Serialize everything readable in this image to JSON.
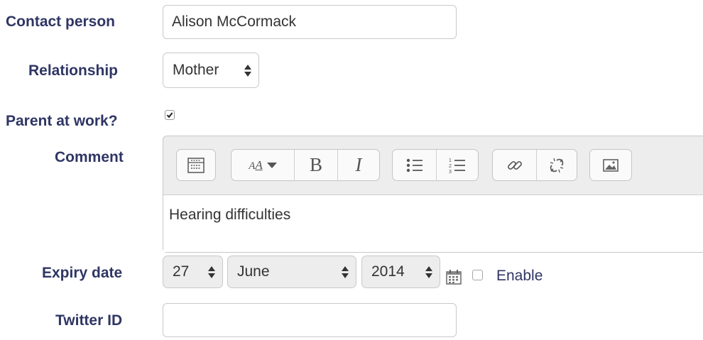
{
  "form": {
    "contact_person": {
      "label": "Contact person",
      "value": "Alison McCormack"
    },
    "relationship": {
      "label": "Relationship",
      "selected": "Mother"
    },
    "parent_at_work": {
      "label": "Parent at work?",
      "checked": true
    },
    "comment": {
      "label": "Comment",
      "text": "Hearing difficulties"
    },
    "expiry_date": {
      "label": "Expiry date",
      "day": "27",
      "month": "June",
      "year": "2014",
      "enable_label": "Enable",
      "enabled": false
    },
    "twitter_id": {
      "label": "Twitter ID",
      "value": ""
    }
  },
  "editor_toolbar": [
    {
      "group": "toggle",
      "buttons": [
        "toolbar-toggle-icon"
      ]
    },
    {
      "group": "format",
      "buttons": [
        "font-style-icon",
        "bold-icon",
        "italic-icon"
      ]
    },
    {
      "group": "lists",
      "buttons": [
        "bullet-list-icon",
        "numbered-list-icon"
      ]
    },
    {
      "group": "links",
      "buttons": [
        "link-icon",
        "unlink-icon"
      ]
    },
    {
      "group": "media",
      "buttons": [
        "image-icon"
      ]
    }
  ],
  "editor_glyphs": {
    "bold": "B",
    "italic": "I",
    "font_a": "A"
  },
  "colors": {
    "label": "#2f3664",
    "select_bg": "#ededed",
    "editor_bg": "#ededed",
    "border": "#c9c9c9"
  }
}
